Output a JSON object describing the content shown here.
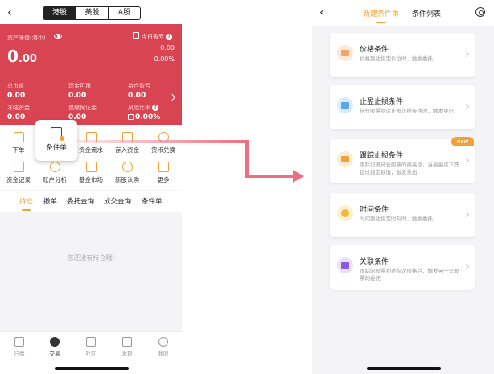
{
  "left": {
    "back": "‹",
    "market_tabs": [
      "港股",
      "美股",
      "A股"
    ],
    "account": {
      "net_asset_label": "资产净值(港币)",
      "net_asset_int": "0",
      "net_asset_dec": ".00",
      "today_pl_label": "今日盈亏",
      "today_pl_value": "0.00",
      "today_pl_pct": "0.00%",
      "stats": [
        {
          "label": "总市值",
          "value": "0.00"
        },
        {
          "label": "现金可用",
          "value": "0.00"
        },
        {
          "label": "持仓盈亏",
          "value": "0.00"
        },
        {
          "label": "冻结资金",
          "value": "0.00"
        },
        {
          "label": "追缴保证金",
          "value": "0.00"
        },
        {
          "label": "风险比率",
          "value": "0.00%"
        }
      ]
    },
    "grid_items": [
      {
        "label": "下单",
        "icon": "order-icon"
      },
      {
        "label": "资金流水",
        "icon": "fund-flow-icon"
      },
      {
        "label": "存入资金",
        "icon": "deposit-icon"
      },
      {
        "label": "货币兑换",
        "icon": "exchange-icon"
      },
      {
        "label": "资金记录",
        "icon": "fund-record-icon"
      },
      {
        "label": "账户分析",
        "icon": "analysis-icon"
      },
      {
        "label": "基金市场",
        "icon": "fund-market-icon"
      },
      {
        "label": "新股认购",
        "icon": "ipo-icon"
      },
      {
        "label": "更多",
        "icon": "more-icon"
      }
    ],
    "popup_label": "条件单",
    "tabs": [
      "持仓",
      "撤单",
      "委托查询",
      "成交查询",
      "条件单"
    ],
    "empty_text": "您还没有持仓哦!",
    "bottom_nav": [
      "行情",
      "交易",
      "社区",
      "发现",
      "我的"
    ]
  },
  "right": {
    "back": "‹",
    "tab_new": "新建条件单",
    "tab_list": "条件列表",
    "conditions": [
      {
        "title": "价格条件",
        "desc": "价格到达指定价位时，触发委托",
        "color": "#f5a36a"
      },
      {
        "title": "止盈止损条件",
        "desc": "持仓股票到达止盈止损条件时，触发卖出",
        "color": "#5aa6e6"
      },
      {
        "title": "跟踪止损条件",
        "desc": "跟踪记录持仓股票的最高点，当最高点下跌超过指定数值，触发卖出",
        "color": "#f0a23a",
        "badge": "new"
      },
      {
        "title": "时间条件",
        "desc": "时间到达指定时刻时，触发委托",
        "color": "#f3b93c"
      },
      {
        "title": "关联条件",
        "desc": "跟踪的股票到达指定价格后，触发另一只股票的委托",
        "color": "#8a5be0"
      }
    ]
  },
  "colors": {
    "accent": "#f0a23a",
    "account_red": "#d94452",
    "arrow": "#ee6e82"
  }
}
